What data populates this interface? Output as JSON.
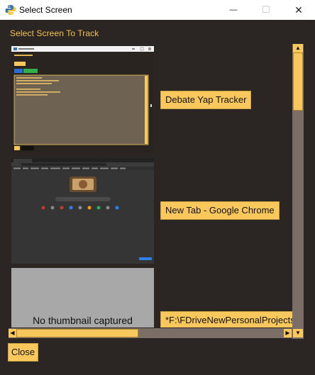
{
  "window": {
    "title": "Select Screen"
  },
  "window_controls": {
    "minimize": "—",
    "maximize": "☐",
    "close": "✕"
  },
  "heading": "Select Screen To Track",
  "items": [
    {
      "label": "Debate Yap Tracker",
      "thumbnail": "screenshot"
    },
    {
      "label": "New Tab - Google Chrome",
      "thumbnail": "screenshot"
    },
    {
      "label": "*F:\\FDriveNewPersonalProjects",
      "thumbnail": "none",
      "thumbnail_text": "No thumbnail captured"
    }
  ],
  "close_label": "Close",
  "colors": {
    "accent": "#f8c85c",
    "heading": "#f4c452",
    "background": "#2b2523",
    "scroll_track": "#7a6e66"
  },
  "scrollbars": {
    "vertical_position": 0,
    "horizontal_position": 0
  }
}
